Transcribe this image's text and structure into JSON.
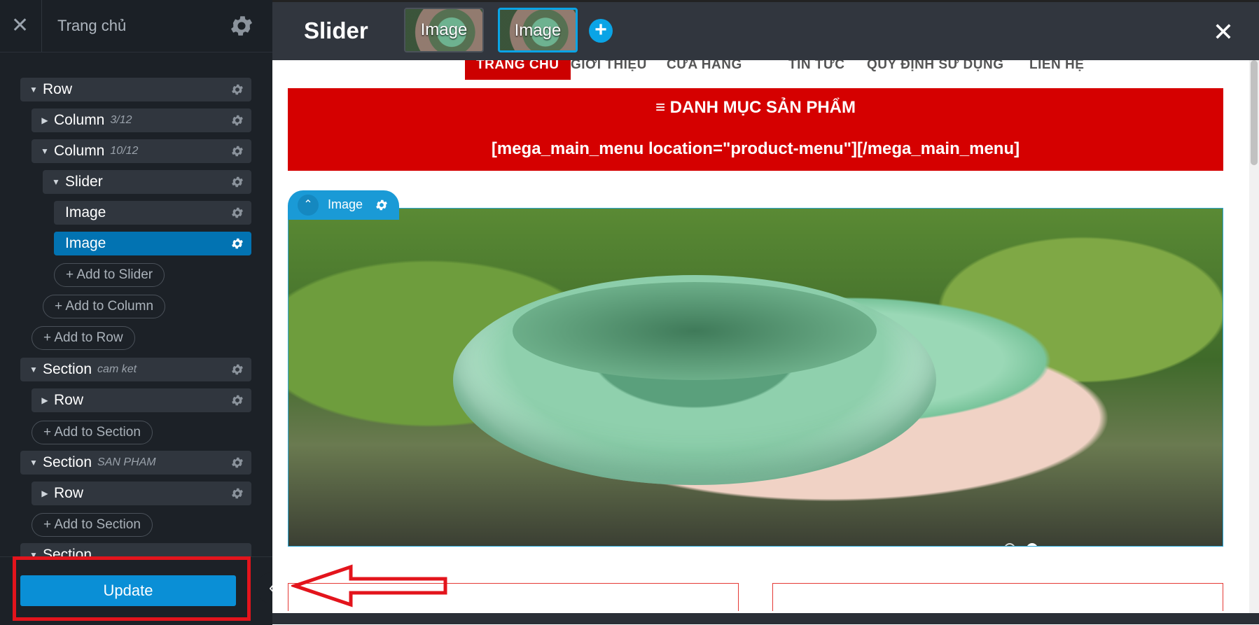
{
  "sidebar": {
    "title": "Trang chủ",
    "tree": {
      "row1": "Row",
      "col1": {
        "label": "Column",
        "sub": "3/12"
      },
      "col2": {
        "label": "Column",
        "sub": "10/12"
      },
      "slider": "Slider",
      "image1": "Image",
      "image2": "Image",
      "add_slider": "+ Add to Slider",
      "add_column": "+ Add to Column",
      "add_row": "+ Add to Row",
      "section1": {
        "label": "Section",
        "sub": "cam ket"
      },
      "section1_row": "Row",
      "add_section1": "+ Add to Section",
      "section2": {
        "label": "Section",
        "sub": "SAN PHAM"
      },
      "section2_row": "Row",
      "add_section2": "+ Add to Section",
      "section3": "Section"
    },
    "update_label": "Update",
    "collapse_icon": "chevron-left-icon"
  },
  "topbar": {
    "title": "Slider",
    "thumbs": [
      "Image",
      "Image"
    ],
    "add_icon": "plus-icon",
    "close_icon": "close-icon"
  },
  "page": {
    "nav": [
      "TRANG CHỦ",
      "GIỚI THIỆU",
      "CỬA HÀNG",
      "TIN TỨC",
      "QUY ĐỊNH SỬ DỤNG",
      "LIÊN HỆ"
    ],
    "category_title": "≡ DANH MỤC SẢN PHẨM",
    "category_code": "[mega_main_menu location=\"product-menu\"][/mega_main_menu]",
    "image_tab_label": "Image"
  },
  "colors": {
    "accent": "#0a8fd6",
    "sidebar_bg": "#1c2127",
    "topbar_bg": "#31363e",
    "category_red": "#d50000",
    "highlight_red": "#e3141c"
  }
}
